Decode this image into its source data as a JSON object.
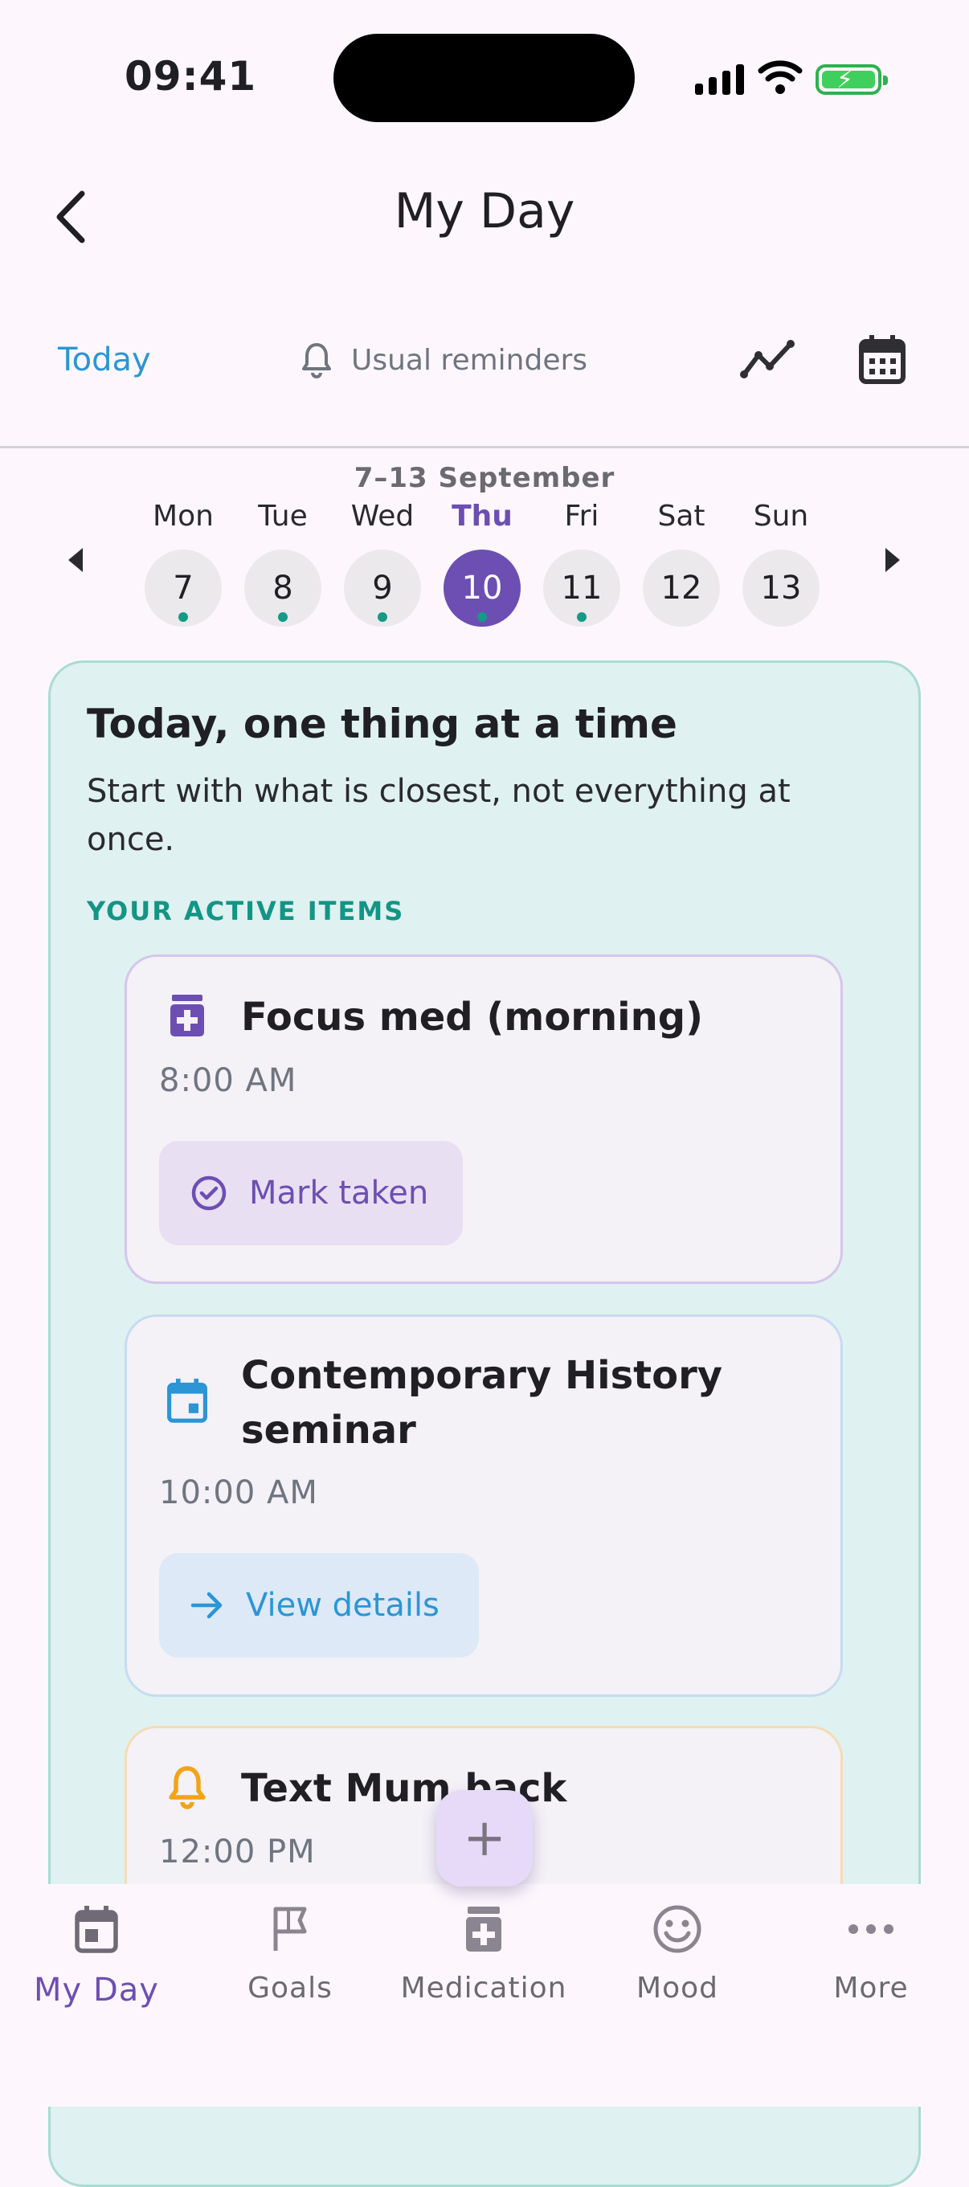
{
  "status_bar": {
    "time": "09:41"
  },
  "header": {
    "title": "My Day",
    "today": "Today",
    "reminders": "Usual reminders"
  },
  "week": {
    "label": "7–13 September",
    "days": [
      {
        "name": "Mon",
        "num": "7",
        "dot": true
      },
      {
        "name": "Tue",
        "num": "8",
        "dot": true
      },
      {
        "name": "Wed",
        "num": "9",
        "dot": true
      },
      {
        "name": "Thu",
        "num": "10",
        "dot": true,
        "selected": true
      },
      {
        "name": "Fri",
        "num": "11",
        "dot": true
      },
      {
        "name": "Sat",
        "num": "12",
        "dot": false
      },
      {
        "name": "Sun",
        "num": "13",
        "dot": false
      }
    ]
  },
  "card": {
    "title": "Today, one thing at a time",
    "subtitle": "Start with what is closest, not everything at once.",
    "section_label": "YOUR ACTIVE ITEMS",
    "items": [
      {
        "title": "Focus med (morning)",
        "time": "8:00 AM",
        "action": "Mark taken",
        "icon": "medication-icon",
        "color": "#6d4eb3"
      },
      {
        "title": "Contemporary History seminar",
        "time": "10:00 AM",
        "action": "View details",
        "icon": "calendar-event-icon",
        "color": "#2b95d6"
      },
      {
        "title": "Text Mum back",
        "time": "12:00 PM",
        "icon": "bell-icon",
        "color": "#f2a417"
      }
    ]
  },
  "fab": {
    "symbol": "+"
  },
  "nav": [
    {
      "label": "My Day",
      "icon": "calendar-icon",
      "active": true
    },
    {
      "label": "Goals",
      "icon": "flag-icon"
    },
    {
      "label": "Medication",
      "icon": "medication-icon"
    },
    {
      "label": "Mood",
      "icon": "smiley-icon"
    },
    {
      "label": "More",
      "icon": "more-dots-icon"
    }
  ]
}
